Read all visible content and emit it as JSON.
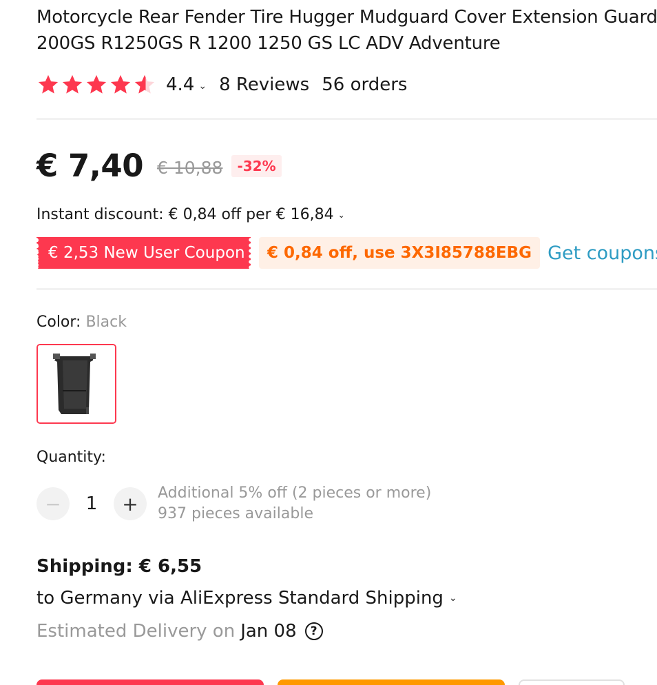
{
  "product": {
    "title_line1": "Motorcycle Rear Fender Tire Hugger Mudguard Cover Extension Guard",
    "title_line2": "200GS R1250GS R 1200 1250 GS LC ADV Adventure"
  },
  "rating": {
    "value": "4.4",
    "stars": 4.4,
    "reviews": "8 Reviews",
    "orders": "56 orders"
  },
  "price": {
    "current": "€ 7,40",
    "original": "€ 10,88",
    "discount": "-32%"
  },
  "instant_discount": "Instant discount: € 0,84 off per € 16,84",
  "coupons": {
    "new_user": "€ 2,53 New User Coupon",
    "code": "€ 0,84 off, use 3X3I85788EBG",
    "get_label": "Get coupons"
  },
  "color": {
    "label": "Color: ",
    "value": "Black"
  },
  "quantity": {
    "label": "Quantity:",
    "value": "1",
    "minus": "−",
    "plus": "+",
    "additional": "Additional 5% off (2 pieces or more)",
    "available": "937 pieces available"
  },
  "shipping": {
    "cost": "Shipping: € 6,55",
    "route": "to Germany via AliExpress Standard Shipping",
    "delivery_label": "Estimated Delivery on",
    "delivery_date": "Jan 08",
    "help": "?"
  },
  "colors": {
    "accent_red": "#fd384f",
    "orange": "#fd6801",
    "link_blue": "#2e9cc3",
    "button_orange": "#ff9900"
  },
  "icons": {
    "star": "star-icon",
    "chevron": "chevron-down-icon",
    "help": "question-circle-icon"
  }
}
